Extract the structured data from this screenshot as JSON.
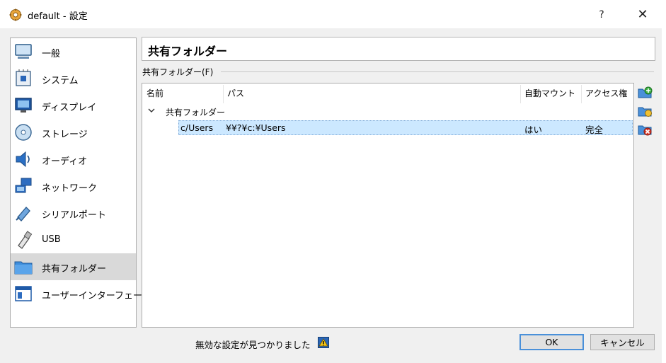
{
  "window": {
    "title": "default - 設定",
    "help_glyph": "?",
    "close_glyph": "✕"
  },
  "sidebar": {
    "items": [
      {
        "label": "一般",
        "icon": "monitor-icon"
      },
      {
        "label": "システム",
        "icon": "chip-icon"
      },
      {
        "label": "ディスプレイ",
        "icon": "display-icon"
      },
      {
        "label": "ストレージ",
        "icon": "disk-icon"
      },
      {
        "label": "オーディオ",
        "icon": "speaker-icon"
      },
      {
        "label": "ネットワーク",
        "icon": "network-icon"
      },
      {
        "label": "シリアルポート",
        "icon": "serial-port-icon"
      },
      {
        "label": "USB",
        "icon": "usb-icon"
      },
      {
        "label": "共有フォルダー",
        "icon": "folder-icon",
        "selected": true
      },
      {
        "label": "ユーザーインターフェース",
        "icon": "ui-window-icon"
      }
    ]
  },
  "main": {
    "title": "共有フォルダー",
    "group_label": "共有フォルダー(F)",
    "table": {
      "headers": [
        "名前",
        "パス",
        "自動マウント",
        "アクセス権"
      ],
      "group_row": "共有フォルダー",
      "rows": [
        {
          "name": "c/Users",
          "path": "¥¥?¥c:¥Users",
          "automount": "はい",
          "access": "完全"
        }
      ]
    }
  },
  "footer": {
    "warning": "無効な設定が見つかりました",
    "ok": "OK",
    "cancel": "キャンセル"
  },
  "colors": {
    "selection": "#cce8ff",
    "sidebar_selected": "#d9d9d9",
    "accent": "#4a90d9"
  }
}
